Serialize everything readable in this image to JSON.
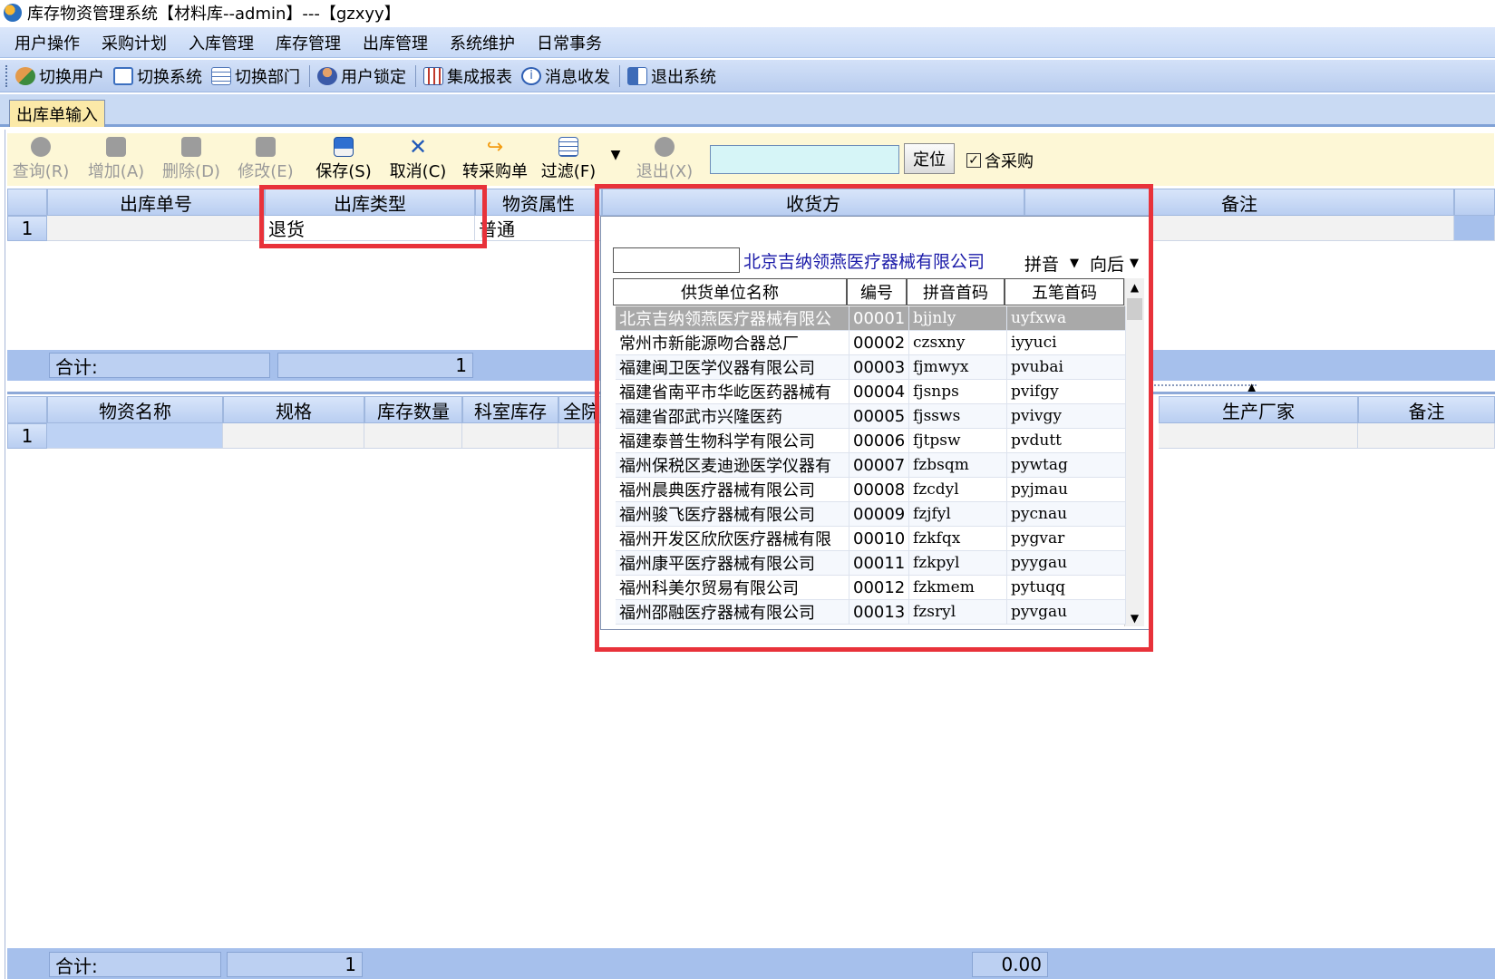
{
  "window": {
    "title": "库存物资管理系统【材料库--admin】---【gzxyy】"
  },
  "menu": [
    "用户操作",
    "采购计划",
    "入库管理",
    "库存管理",
    "出库管理",
    "系统维护",
    "日常事务"
  ],
  "toolbar": {
    "switch_user": "切换用户",
    "switch_system": "切换系统",
    "switch_dept": "切换部门",
    "user_lock": "用户锁定",
    "integrated_report": "集成报表",
    "messages": "消息收发",
    "exit_system": "退出系统"
  },
  "tab": {
    "label": "出库单输入"
  },
  "actions": {
    "query": "查询(R)",
    "add": "增加(A)",
    "delete": "删除(D)",
    "edit": "修改(E)",
    "save": "保存(S)",
    "cancel": "取消(C)",
    "to_purchase": "转采购单",
    "filter": "过滤(F)",
    "exit": "退出(X)",
    "locate": "定位",
    "include_purchase": "含采购"
  },
  "header_grid": {
    "columns": [
      "出库单号",
      "出库类型",
      "物资属性",
      "收货方",
      "备注"
    ],
    "row": {
      "index": "1",
      "order_no": "",
      "type": "退货",
      "attribute": "普通",
      "receiver": "",
      "remark": ""
    },
    "total_label": "合计:",
    "total_value": "1"
  },
  "detail_grid": {
    "columns": [
      "物资名称",
      "规格",
      "库存数量",
      "科室库存",
      "全院",
      "生产厂家",
      "备注"
    ],
    "row_index": "1",
    "total_label": "合计:",
    "total_value": "1",
    "amount": "0.00"
  },
  "dropdown": {
    "search_value": "",
    "selected_name": "北京吉纳领燕医疗器械有限公司",
    "mode": "拼音",
    "direction": "向后",
    "columns": [
      "供货单位名称",
      "编号",
      "拼音首码",
      "五笔首码"
    ],
    "rows": [
      [
        "北京吉纳领燕医疗器械有限公",
        "00001",
        "bjjnly",
        "uyfxwa"
      ],
      [
        "常州市新能源吻合器总厂",
        "00002",
        "czsxny",
        "iyyuci"
      ],
      [
        "福建闽卫医学仪器有限公司",
        "00003",
        "fjmwyx",
        "pvubai"
      ],
      [
        "福建省南平市华屹医药器械有",
        "00004",
        "fjsnps",
        "pvifgy"
      ],
      [
        "福建省邵武市兴隆医药",
        "00005",
        "fjssws",
        "pvivgy"
      ],
      [
        "福建泰普生物科学有限公司",
        "00006",
        "fjtpsw",
        "pvdutt"
      ],
      [
        "福州保税区麦迪逊医学仪器有",
        "00007",
        "fzbsqm",
        "pywtag"
      ],
      [
        "福州晨典医疗器械有限公司",
        "00008",
        "fzcdyl",
        "pyjmau"
      ],
      [
        "福州骏飞医疗器械有限公司",
        "00009",
        "fzjfyl",
        "pycnau"
      ],
      [
        "福州开发区欣欣医疗器械有限",
        "00010",
        "fzkfqx",
        "pygvar"
      ],
      [
        "福州康平医疗器械有限公司",
        "00011",
        "fzkpyl",
        "pyygau"
      ],
      [
        "福州科美尔贸易有限公司",
        "00012",
        "fzkmem",
        "pytuqq"
      ],
      [
        "福州邵融医疗器械有限公司",
        "00013",
        "fzsryl",
        "pyvgau"
      ]
    ]
  }
}
